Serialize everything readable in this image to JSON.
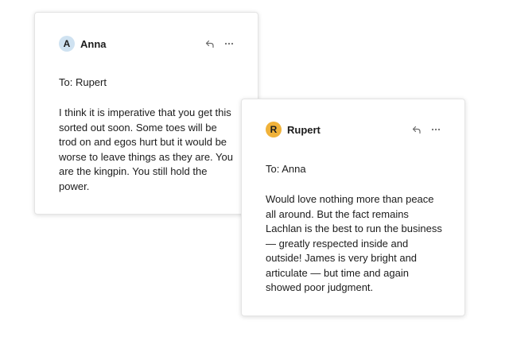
{
  "colors": {
    "anna_avatar_bg": "#cfe2f1",
    "rupert_avatar_bg": "#f0b23a",
    "icon_color": "#6b6b6b"
  },
  "messages": [
    {
      "avatar_initial": "A",
      "sender": "Anna",
      "to": "To: Rupert",
      "body": "I think it is imperative that you get this sorted out soon. Some toes will be trod on and egos hurt but it would be worse to leave things as they are. You are the kingpin. You still hold the power.",
      "icons": [
        "reply-icon",
        "more-options-icon"
      ]
    },
    {
      "avatar_initial": "R",
      "sender": "Rupert",
      "to": "To: Anna",
      "body": "Would love nothing more than peace all around. But the fact remains Lachlan is the best to run the business — greatly respected inside and outside! James is very bright and articulate — but time and again showed poor judgment.",
      "icons": [
        "reply-icon",
        "more-options-icon"
      ]
    }
  ]
}
